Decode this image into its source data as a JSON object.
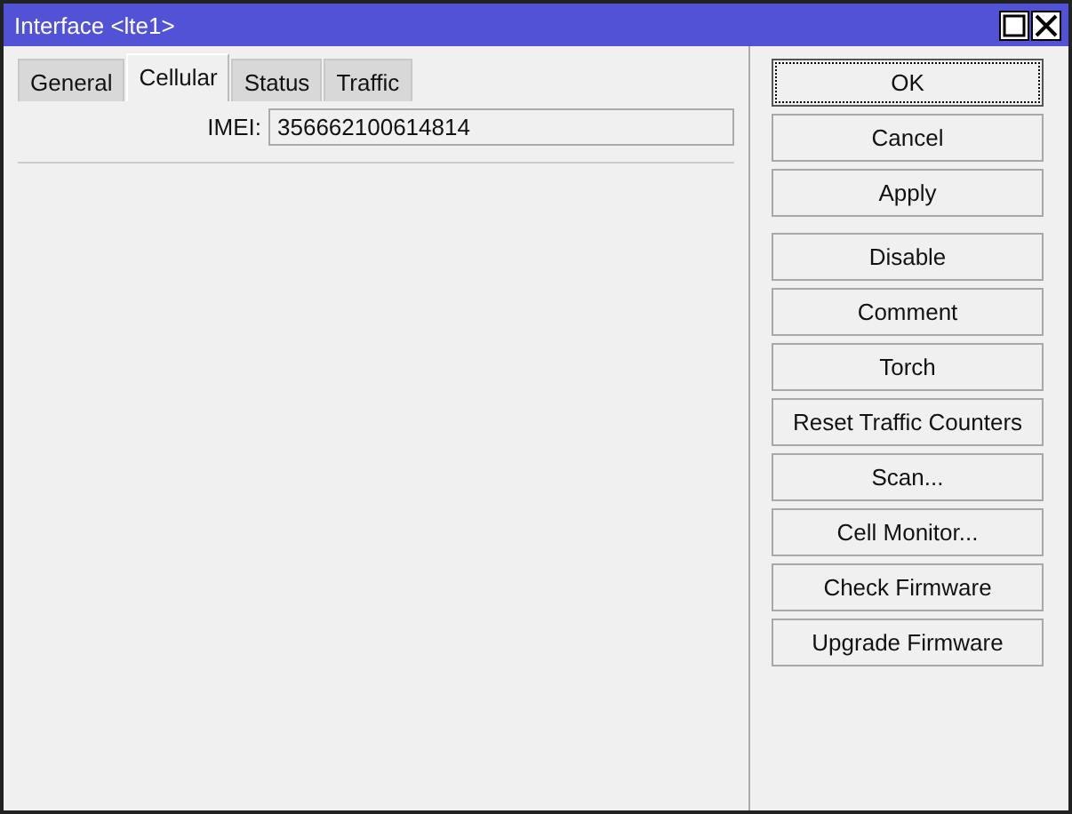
{
  "window": {
    "title": "Interface <lte1>"
  },
  "tabs": [
    {
      "label": "General",
      "selected": false
    },
    {
      "label": "Cellular",
      "selected": true
    },
    {
      "label": "Status",
      "selected": false
    },
    {
      "label": "Traffic",
      "selected": false
    }
  ],
  "fields": [
    {
      "label": "IMEI:",
      "value": "356662100614814"
    }
  ],
  "button_groups": [
    [
      {
        "label": "OK",
        "focused": true
      },
      {
        "label": "Cancel",
        "focused": false
      },
      {
        "label": "Apply",
        "focused": false
      }
    ],
    [
      {
        "label": "Disable",
        "focused": false
      },
      {
        "label": "Comment",
        "focused": false
      },
      {
        "label": "Torch",
        "focused": false
      },
      {
        "label": "Reset Traffic Counters",
        "focused": false
      },
      {
        "label": "Scan...",
        "focused": false
      },
      {
        "label": "Cell Monitor...",
        "focused": false
      },
      {
        "label": "Check Firmware",
        "focused": false
      },
      {
        "label": "Upgrade Firmware",
        "focused": false
      }
    ]
  ]
}
